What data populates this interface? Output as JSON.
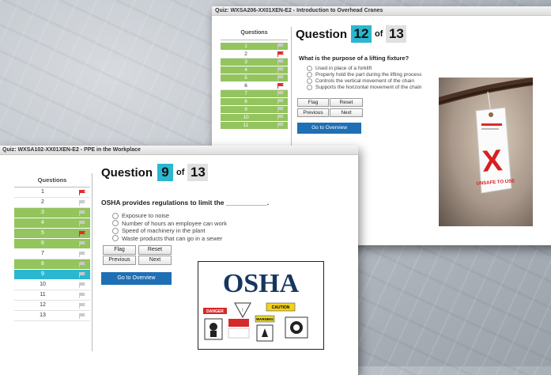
{
  "back": {
    "title": "Quiz: WXSA206-XX01XEN-E2 - Introduction to Overhead Cranes",
    "questions_header": "Questions",
    "question_label": "Question",
    "current": "12",
    "of_label": "of",
    "total": "13",
    "prompt": "What is the purpose of a lifting fixture?",
    "options": [
      "Used in place of a forklift",
      "Properly hold the part during the lifting process",
      "Controls the vertical movement of the chain",
      "Supports the horizontal movement of the chain"
    ],
    "buttons": {
      "flag": "Flag",
      "reset": "Reset",
      "previous": "Previous",
      "next": "Next",
      "overview": "Go to Overview"
    },
    "rows": [
      {
        "n": "1",
        "state": "answered",
        "flagged": false
      },
      {
        "n": "2",
        "state": "plain",
        "flagged": true
      },
      {
        "n": "3",
        "state": "answered",
        "flagged": false
      },
      {
        "n": "4",
        "state": "answered",
        "flagged": false
      },
      {
        "n": "5",
        "state": "answered",
        "flagged": false
      },
      {
        "n": "6",
        "state": "plain",
        "flagged": true
      },
      {
        "n": "7",
        "state": "answered",
        "flagged": false
      },
      {
        "n": "8",
        "state": "answered",
        "flagged": false
      },
      {
        "n": "9",
        "state": "answered",
        "flagged": false
      },
      {
        "n": "10",
        "state": "answered",
        "flagged": false
      },
      {
        "n": "11",
        "state": "answered",
        "flagged": false
      }
    ],
    "image": {
      "tag_text": "UNSAFE TO USE",
      "tag_small": "DO NOT USE"
    }
  },
  "front": {
    "title": "Quiz: WXSA102-XX01XEN-E2 - PPE in the Workplace",
    "questions_header": "Questions",
    "question_label": "Question",
    "current": "9",
    "of_label": "of",
    "total": "13",
    "prompt": "OSHA provides regulations to limit the ___________.",
    "options": [
      "Exposure to noise",
      "Number of hours an employee can work",
      "Speed of machinery in the plant",
      "Waste products that can go in a sewer"
    ],
    "buttons": {
      "flag": "Flag",
      "reset": "Reset",
      "previous": "Previous",
      "next": "Next",
      "overview": "Go to Overview"
    },
    "rows": [
      {
        "n": "1",
        "state": "plain",
        "flagged": true
      },
      {
        "n": "2",
        "state": "plain",
        "flagged": false
      },
      {
        "n": "3",
        "state": "answered",
        "flagged": false
      },
      {
        "n": "4",
        "state": "answered",
        "flagged": false
      },
      {
        "n": "5",
        "state": "answered",
        "flagged": true
      },
      {
        "n": "6",
        "state": "answered",
        "flagged": false
      },
      {
        "n": "7",
        "state": "plain",
        "flagged": false
      },
      {
        "n": "8",
        "state": "answered",
        "flagged": false
      },
      {
        "n": "9",
        "state": "current",
        "flagged": false
      },
      {
        "n": "10",
        "state": "plain",
        "flagged": false
      },
      {
        "n": "11",
        "state": "plain",
        "flagged": false
      },
      {
        "n": "12",
        "state": "plain",
        "flagged": false
      },
      {
        "n": "13",
        "state": "plain",
        "flagged": false
      }
    ],
    "image": {
      "logo": "OSHA",
      "signs": {
        "danger": "DANGER",
        "caution": "CAUTION",
        "warning": "WARNING"
      }
    }
  },
  "colors": {
    "answered": "#94c45e",
    "current": "#2bb7cf",
    "flag_red": "#e32b2b",
    "flag_gray": "#c9c9c9",
    "overview": "#1f6fb4"
  }
}
